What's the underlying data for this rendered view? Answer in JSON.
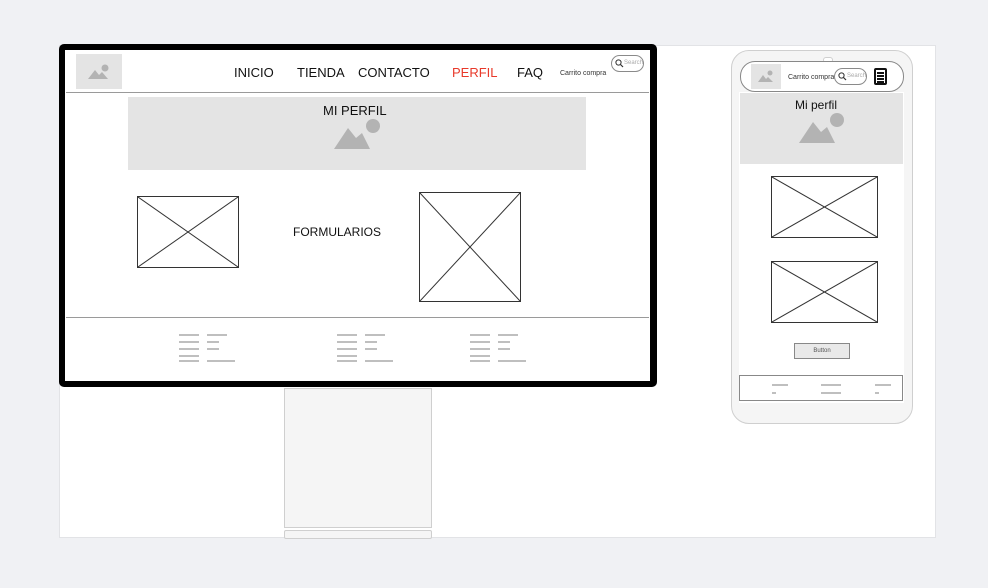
{
  "desktop": {
    "nav": {
      "items": [
        "INICIO",
        "TIENDA",
        "CONTACTO",
        "PERFIL",
        "FAQ"
      ],
      "active": "PERFIL",
      "cart": "Carrito compra",
      "search_placeholder": "Search"
    },
    "hero_title": "MI PERFIL",
    "form_label": "FORMULARIOS"
  },
  "mobile": {
    "cart": "Carrito compra",
    "search_placeholder": "Search",
    "hero_title": "Mi perfil",
    "button_label": "Button"
  },
  "colors": {
    "active_nav": "#e8392a",
    "placeholder": "#e4e4e4",
    "frame": "#000000"
  }
}
